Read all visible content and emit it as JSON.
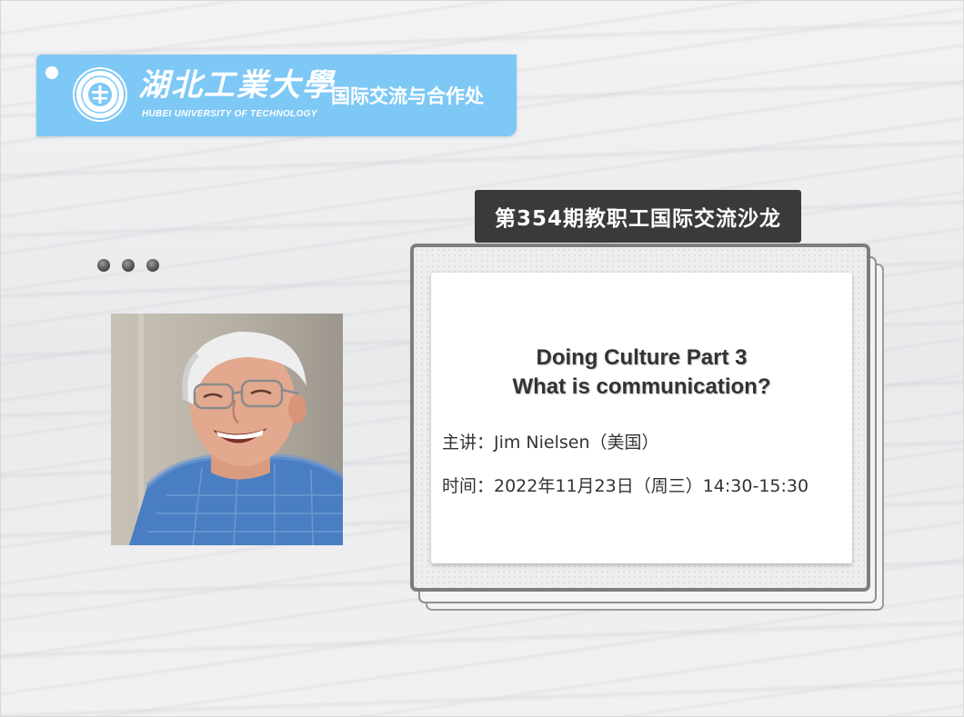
{
  "header": {
    "university_cn": "湖北工業大學",
    "university_en": "HUBEI UNIVERSITY OF TECHNOLOGY",
    "department": "国际交流与合作处",
    "banner_color": "#7ec8f6"
  },
  "salon": {
    "label": "第354期教职工国际交流沙龙"
  },
  "talk": {
    "title_line1": "Doing Culture Part 3",
    "title_line2": "What is communication?",
    "speaker_line": "主讲：Jim Nielsen（美国）",
    "time_line": "时间：2022年11月23日（周三）14:30-15:30"
  },
  "icons": {
    "logo": "university-seal-icon",
    "dots": "ellipsis-dots-icon"
  },
  "colors": {
    "tag_bg": "#3a3a3a",
    "frame_border": "#7d7d7d",
    "text": "#333333"
  }
}
